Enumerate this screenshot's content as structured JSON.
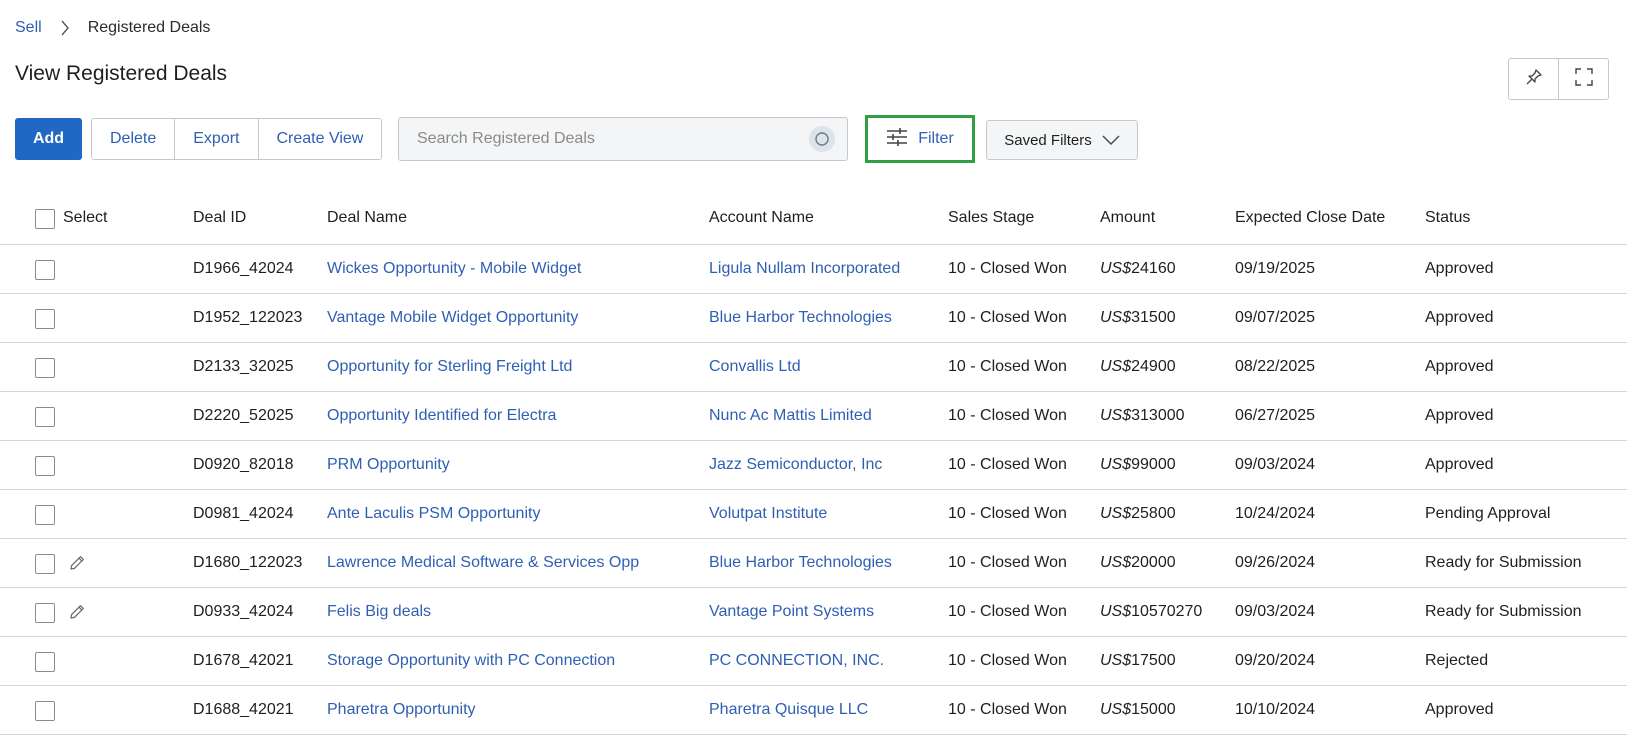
{
  "breadcrumb": {
    "parent": "Sell",
    "current": "Registered Deals"
  },
  "page_title": "View Registered Deals",
  "toolbar": {
    "add_label": "Add",
    "delete_label": "Delete",
    "export_label": "Export",
    "create_view_label": "Create View",
    "filter_label": "Filter",
    "saved_filters_label": "Saved Filters"
  },
  "search": {
    "placeholder": "Search Registered Deals",
    "value": ""
  },
  "icons": {
    "pin": "pin-icon",
    "fullscreen": "fullscreen-icon",
    "search": "search-icon",
    "filter": "sliders-icon",
    "chevron": "chevron-down-icon",
    "edit": "pencil-icon"
  },
  "colors": {
    "accent": "#2167c4",
    "link": "#2f5fb3",
    "highlight": "#2ea043"
  },
  "table": {
    "headers": [
      "Select",
      "Deal ID",
      "Deal Name",
      "Account Name",
      "Sales Stage",
      "Amount",
      "Expected Close Date",
      "Status"
    ],
    "currency_prefix": "US$",
    "rows": [
      {
        "id": "D1966_42024",
        "name": "Wickes Opportunity - Mobile Widget",
        "account": "Ligula Nullam Incorporated",
        "stage": "10 - Closed Won",
        "amount": "24160",
        "date": "09/19/2025",
        "status": "Approved",
        "editable": false
      },
      {
        "id": "D1952_122023",
        "name": "Vantage Mobile Widget Opportunity",
        "account": "Blue Harbor Technologies",
        "stage": "10 - Closed Won",
        "amount": "31500",
        "date": "09/07/2025",
        "status": "Approved",
        "editable": false
      },
      {
        "id": "D2133_32025",
        "name": "Opportunity for Sterling Freight Ltd",
        "account": "Convallis Ltd",
        "stage": "10 - Closed Won",
        "amount": "24900",
        "date": "08/22/2025",
        "status": "Approved",
        "editable": false
      },
      {
        "id": "D2220_52025",
        "name": "Opportunity Identified for Electra",
        "account": "Nunc Ac Mattis Limited",
        "stage": "10 - Closed Won",
        "amount": "313000",
        "date": "06/27/2025",
        "status": "Approved",
        "editable": false
      },
      {
        "id": "D0920_82018",
        "name": "PRM Opportunity",
        "account": "Jazz Semiconductor, Inc",
        "stage": "10 - Closed Won",
        "amount": "99000",
        "date": "09/03/2024",
        "status": "Approved",
        "editable": false
      },
      {
        "id": "D0981_42024",
        "name": "Ante Laculis PSM Opportunity",
        "account": "Volutpat Institute",
        "stage": "10 - Closed Won",
        "amount": "25800",
        "date": "10/24/2024",
        "status": "Pending Approval",
        "editable": false
      },
      {
        "id": "D1680_122023",
        "name": "Lawrence Medical Software & Services Opp",
        "account": "Blue Harbor Technologies",
        "stage": "10 - Closed Won",
        "amount": "20000",
        "date": "09/26/2024",
        "status": "Ready for Submission",
        "editable": true
      },
      {
        "id": "D0933_42024",
        "name": "Felis Big deals",
        "account": "Vantage Point Systems",
        "stage": "10 - Closed Won",
        "amount": "10570270",
        "date": "09/03/2024",
        "status": "Ready for Submission",
        "editable": true
      },
      {
        "id": "D1678_42021",
        "name": "Storage Opportunity with PC Connection",
        "account": "PC CONNECTION, INC.",
        "stage": "10 - Closed Won",
        "amount": "17500",
        "date": "09/20/2024",
        "status": "Rejected",
        "editable": false
      },
      {
        "id": "D1688_42021",
        "name": "Pharetra Opportunity",
        "account": "Pharetra Quisque LLC",
        "stage": "10 - Closed Won",
        "amount": "15000",
        "date": "10/10/2024",
        "status": "Approved",
        "editable": false
      }
    ]
  }
}
